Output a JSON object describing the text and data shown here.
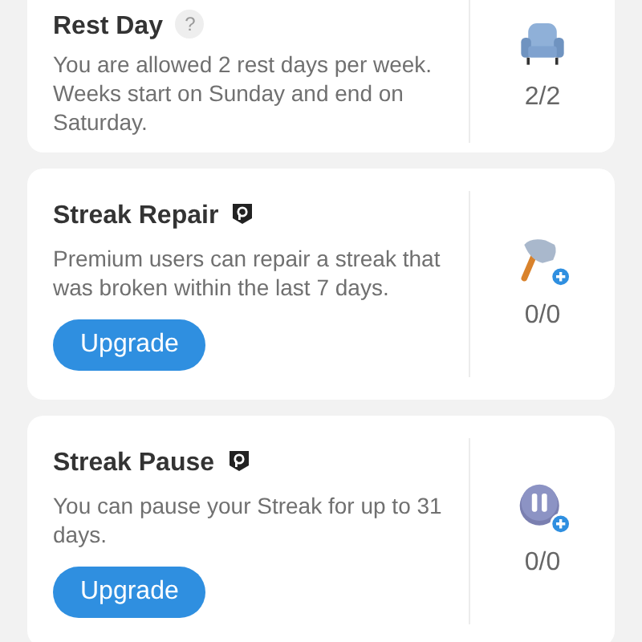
{
  "cards": [
    {
      "kind": "rest_day",
      "title": "Rest Day",
      "help_mark": "?",
      "premium": false,
      "description": "You are allowed 2 rest days per week. Weeks start on Sunday and end on Saturday.",
      "count": "2/2"
    },
    {
      "kind": "repair",
      "title": "Streak Repair",
      "premium": true,
      "description": "Premium users can repair a streak that was broken within the last 7 days.",
      "button": "Upgrade",
      "count": "0/0"
    },
    {
      "kind": "pause",
      "title": "Streak Pause",
      "premium": true,
      "description": "You can pause your Streak for up to 31 days.",
      "button": "Upgrade",
      "count": "0/0"
    }
  ]
}
